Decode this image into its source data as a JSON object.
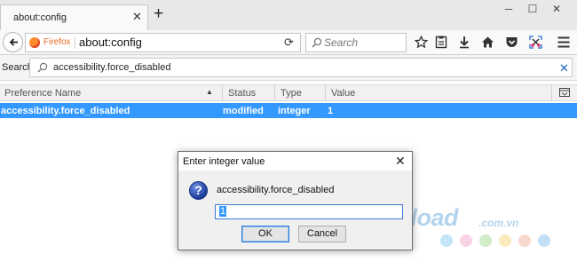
{
  "tab": {
    "title": "about:config"
  },
  "navbar": {
    "identity_label": "Firefox",
    "url": "about:config",
    "search_placeholder": "Search"
  },
  "filter": {
    "label": "Search:",
    "value": "accessibility.force_disabled"
  },
  "table": {
    "columns": [
      "Preference Name",
      "Status",
      "Type",
      "Value"
    ],
    "rows": [
      {
        "name": "accessibility.force_disabled",
        "status": "modified",
        "type": "integer",
        "value": "1"
      }
    ]
  },
  "dialog": {
    "title": "Enter integer value",
    "icon_glyph": "?",
    "message": "accessibility.force_disabled",
    "input_value": "1",
    "ok_label": "OK",
    "cancel_label": "Cancel"
  },
  "watermark": {
    "text": "Download",
    "domain": ".com.vn",
    "dot_colors": [
      "#78c8f0",
      "#f4a0c8",
      "#9ad88a",
      "#f8d070",
      "#f0a890",
      "#78b8f0"
    ]
  },
  "colors": {
    "selection": "#3399ff",
    "firefox_orange": "#e76b1f"
  }
}
